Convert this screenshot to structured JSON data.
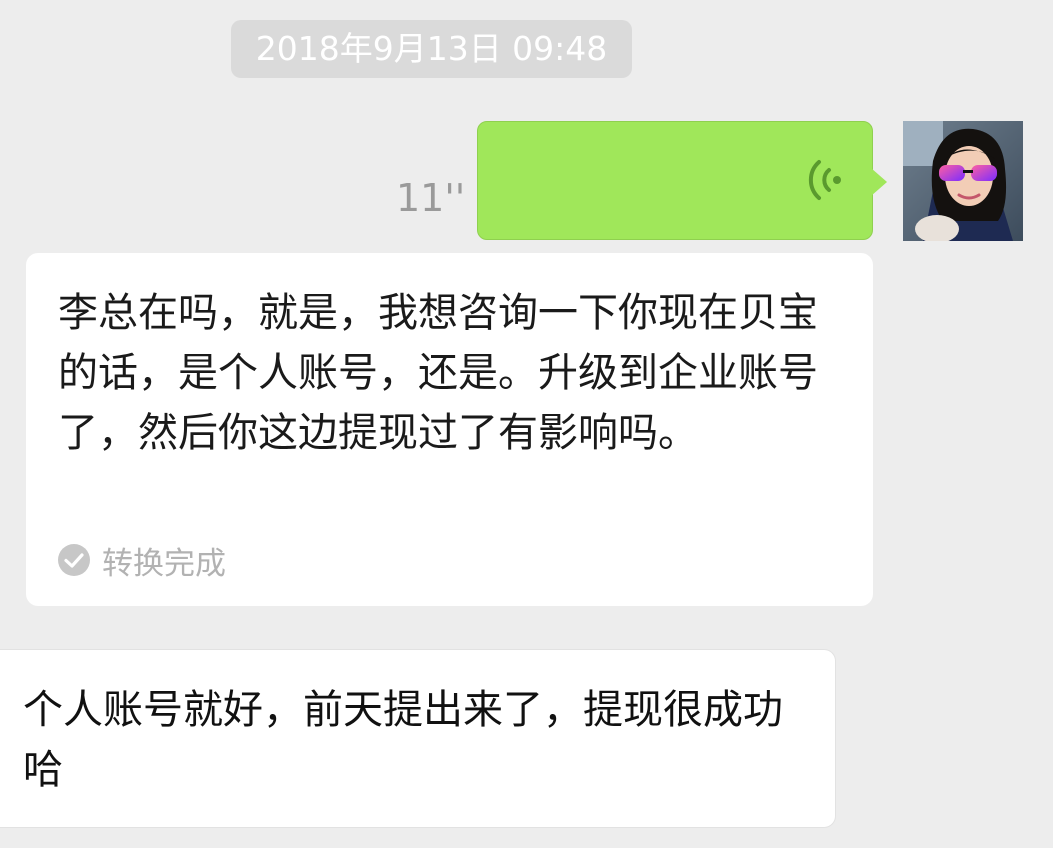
{
  "timestamp": "2018年9月13日 09:48",
  "voice_message": {
    "duration": "11''",
    "bubble_color": "#a0e75a",
    "icon": "voice-wave-icon"
  },
  "avatar": {
    "icon": "user-avatar"
  },
  "transcript": {
    "text": "李总在吗，就是，我想咨询一下你现在贝宝的话，是个人账号，还是。升级到企业账号了，然后你这边提现过了有影响吗。",
    "status_label": "转换完成",
    "status_icon": "check-circle-icon"
  },
  "reply": {
    "text": "个人账号就好，前天提出来了，提现很成功哈"
  },
  "colors": {
    "background": "#ededed",
    "bubble_self": "#a0e75a",
    "bubble_other": "#ffffff",
    "timestamp_bg": "#dadada"
  }
}
